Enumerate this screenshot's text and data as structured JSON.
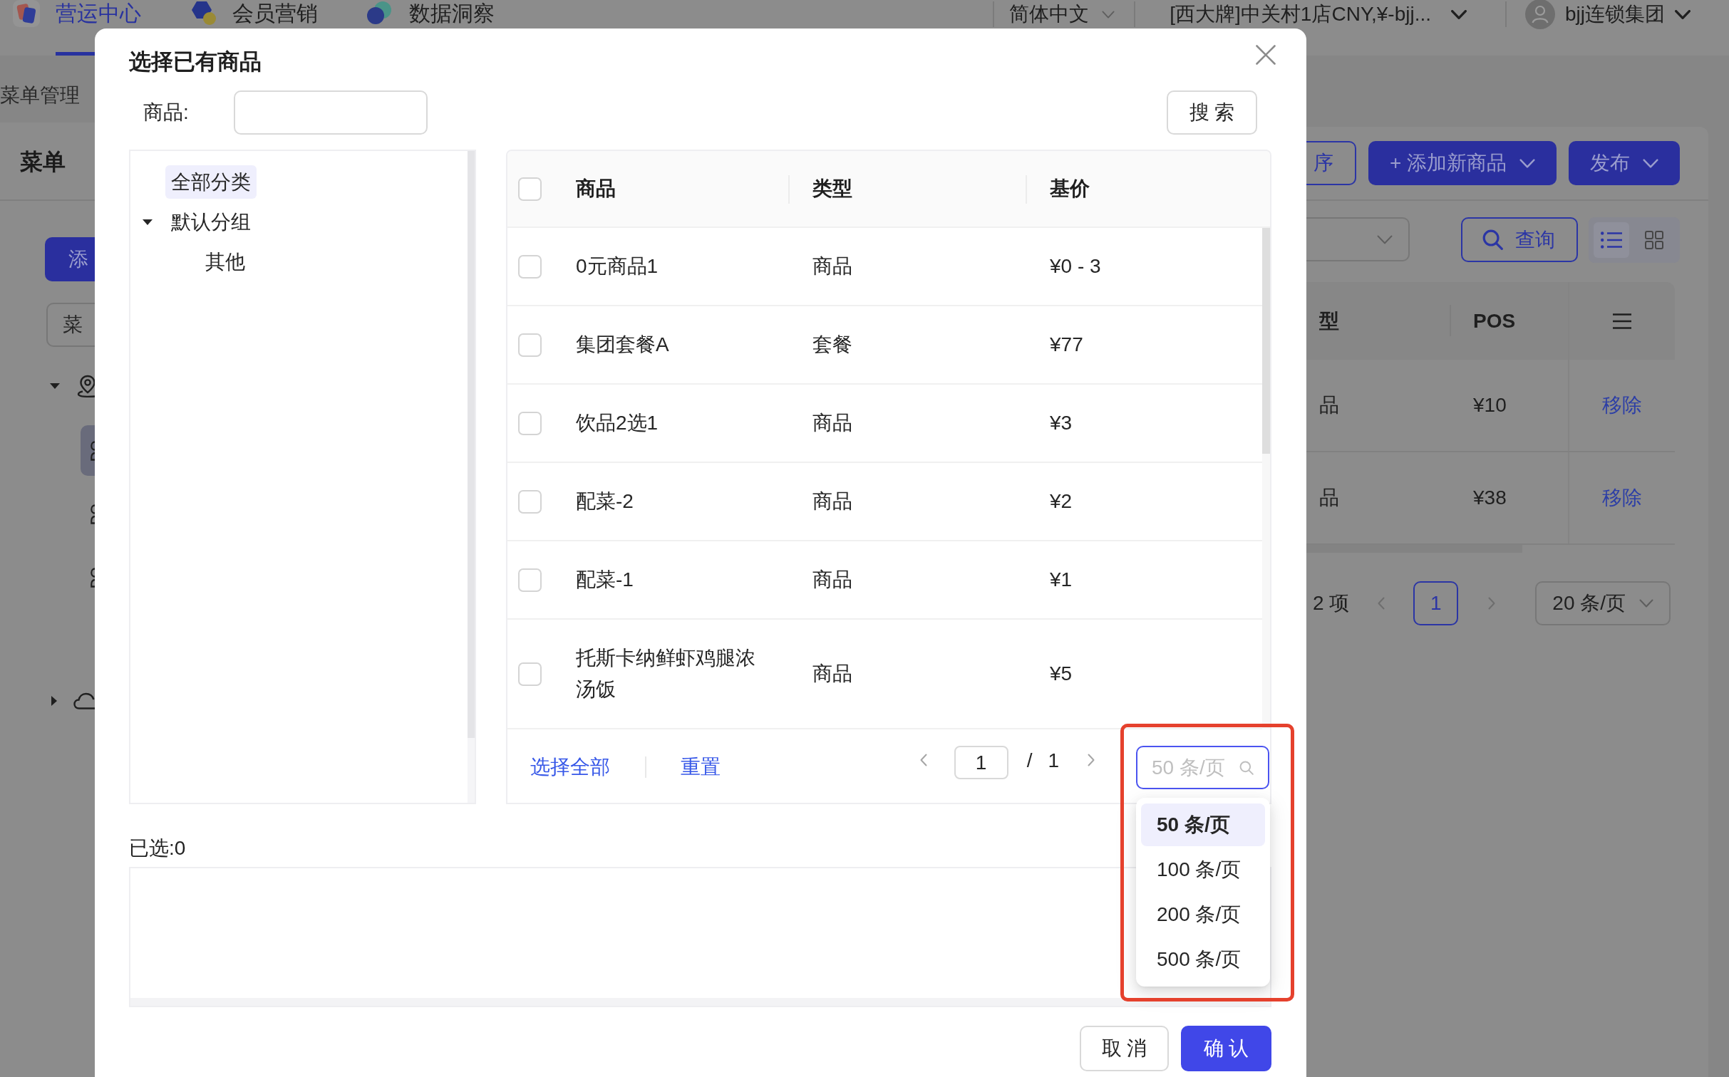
{
  "top_nav": {
    "tabs": [
      {
        "label": "营运中心",
        "selected": true
      },
      {
        "label": "会员营销",
        "selected": false
      },
      {
        "label": "数据洞察",
        "selected": false
      }
    ],
    "language": "简体中文",
    "store": "[西大牌]中关村1店CNY,¥-bjj...",
    "account": "bjj连锁集团"
  },
  "page": {
    "breadcrumb": "菜单管理",
    "title": "菜单",
    "add_button": "添",
    "menu_select": "菜",
    "sidebar_tree": [
      {
        "expanded": true,
        "children": [
          {
            "selected": true
          },
          {
            "selected": false
          },
          {
            "selected": false
          }
        ]
      },
      {
        "expanded": false
      }
    ],
    "toolbar": [
      {
        "label": "序",
        "kind": "outline"
      },
      {
        "label": "+ 添加新商品",
        "kind": "primary"
      },
      {
        "label": "发布",
        "kind": "primary"
      }
    ],
    "query_button": "查询",
    "view_modes": [
      {
        "kind": "list",
        "selected": true
      },
      {
        "kind": "grid",
        "selected": false
      }
    ],
    "table": {
      "columns": [
        "型",
        "POS"
      ],
      "rows": [
        {
          "type": "品",
          "pos": "¥10",
          "action": "移除"
        },
        {
          "type": "品",
          "pos": "¥38",
          "action": "移除"
        }
      ]
    },
    "pagination": {
      "total": "2 项",
      "pages": [
        {
          "label": "1",
          "selected": true
        }
      ],
      "page_size": "20 条/页"
    }
  },
  "dialog": {
    "title": "选择已有商品",
    "search": {
      "label": "商品:",
      "button": "搜 索"
    },
    "tree": [
      {
        "label": "全部分类",
        "selected": true
      },
      {
        "label": "默认分组",
        "selected": false,
        "expanded": true,
        "children": [
          {
            "label": "其他",
            "selected": false
          }
        ]
      }
    ],
    "table": {
      "all_checked": false,
      "columns": [
        "商品",
        "类型",
        "基价"
      ],
      "rows": [
        {
          "product": "0元商品1",
          "type": "商品",
          "price": "¥0 - 3",
          "checked": false
        },
        {
          "product": "集团套餐A",
          "type": "套餐",
          "price": "¥77",
          "checked": false
        },
        {
          "product": "饮品2选1",
          "type": "商品",
          "price": "¥3",
          "checked": false
        },
        {
          "product": "配菜-2",
          "type": "商品",
          "price": "¥2",
          "checked": false
        },
        {
          "product": "配菜-1",
          "type": "商品",
          "price": "¥1",
          "checked": false
        },
        {
          "product": "托斯卡纳鲜虾鸡腿浓汤饭",
          "type": "商品",
          "price": "¥5",
          "checked": false
        }
      ]
    },
    "footer_links": [
      "选择全部",
      "重置"
    ],
    "pager": {
      "current": "1",
      "separator": "/",
      "total": "1"
    },
    "page_size": {
      "value": "50 条/页",
      "open": true,
      "highlighted": true,
      "options": [
        {
          "label": "50 条/页",
          "selected": true
        },
        {
          "label": "100 条/页",
          "selected": false
        },
        {
          "label": "200 条/页",
          "selected": false
        },
        {
          "label": "500 条/页",
          "selected": false
        }
      ]
    },
    "selected_count": "已选:0",
    "buttons": [
      {
        "label": "取 消",
        "kind": "default"
      },
      {
        "label": "确 认",
        "kind": "primary"
      }
    ]
  }
}
